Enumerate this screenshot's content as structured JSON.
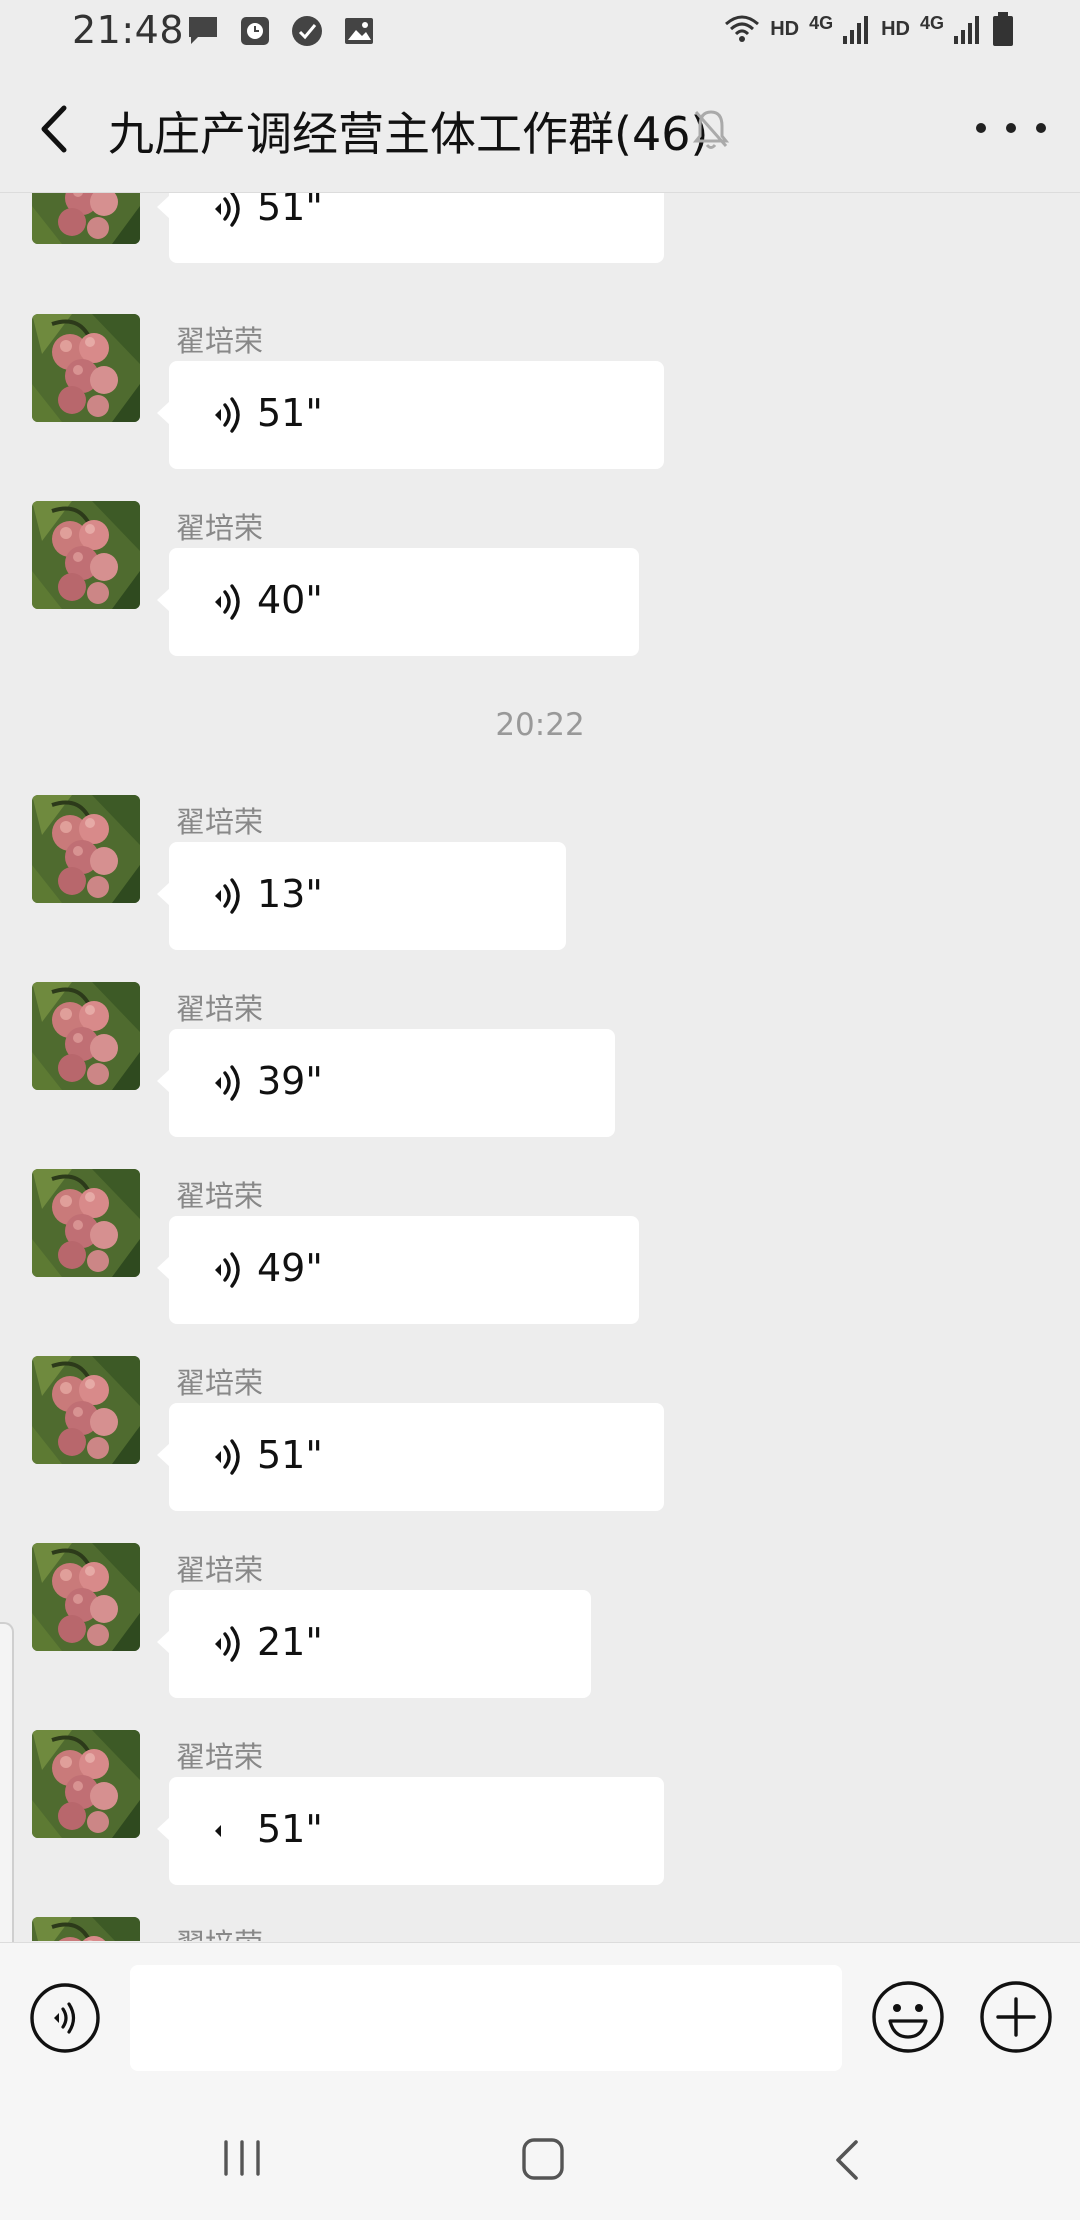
{
  "status_bar": {
    "time": "21:48",
    "hd_1": "HD",
    "net_1": "4G",
    "hd_2": "HD",
    "net_2": "4G"
  },
  "header": {
    "title": "九庄产调经营主体工作群(46)"
  },
  "timestamp": "20:22",
  "messages": [
    {
      "sender": "",
      "duration": "51\""
    },
    {
      "sender": "翟培荣",
      "duration": "51\""
    },
    {
      "sender": "翟培荣",
      "duration": "40\""
    },
    {
      "sender": "翟培荣",
      "duration": "13\""
    },
    {
      "sender": "翟培荣",
      "duration": "39\""
    },
    {
      "sender": "翟培荣",
      "duration": "49\""
    },
    {
      "sender": "翟培荣",
      "duration": "51\""
    },
    {
      "sender": "翟培荣",
      "duration": "21\""
    },
    {
      "sender": "翟培荣",
      "duration": "51\""
    },
    {
      "sender": "翟培荣",
      "duration": ""
    }
  ],
  "input": {
    "value": "",
    "placeholder": ""
  },
  "icons": {
    "back": "chevron-left-icon",
    "mute": "bell-off-icon",
    "more": "more-horizontal-icon",
    "voice": "voice-wave-icon",
    "emoji": "smiley-icon",
    "plus": "plus-circle-icon"
  },
  "colors": {
    "background": "#ededed",
    "bubble": "#ffffff",
    "sender_text": "#888888",
    "input_bar": "#f6f6f6"
  }
}
